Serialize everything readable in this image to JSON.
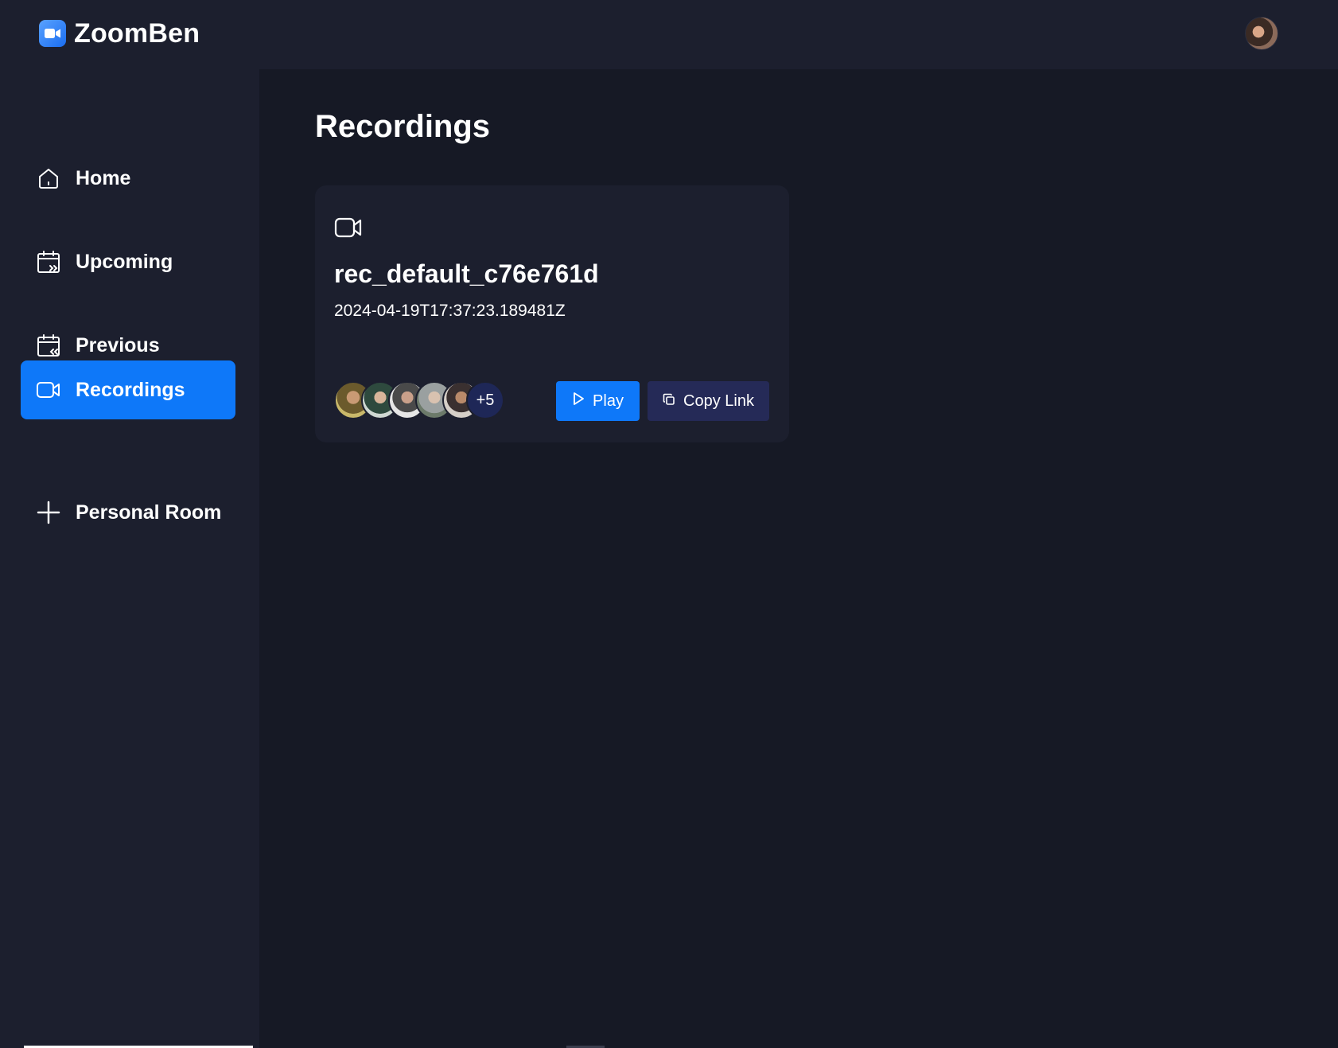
{
  "app": {
    "name": "ZoomBen"
  },
  "sidebar": {
    "items": [
      {
        "label": "Home",
        "icon": "home-icon",
        "active": false
      },
      {
        "label": "Upcoming",
        "icon": "calendar-forward-icon",
        "active": false
      },
      {
        "label": "Previous",
        "icon": "calendar-back-icon",
        "active": false
      },
      {
        "label": "Recordings",
        "icon": "video-icon",
        "active": true
      },
      {
        "label": "Personal Room",
        "icon": "plus-icon",
        "active": false
      }
    ]
  },
  "main": {
    "title": "Recordings",
    "recordings": [
      {
        "title": "rec_default_c76e761d",
        "date": "2024-04-19T17:37:23.189481Z",
        "attendees_more": "+5",
        "play_label": "Play",
        "copy_label": "Copy Link"
      }
    ]
  },
  "colors": {
    "accent": "#0e78f9",
    "sidebar_bg": "#1c1f2e",
    "main_bg": "#161925",
    "copy_button_bg": "#252a57"
  }
}
